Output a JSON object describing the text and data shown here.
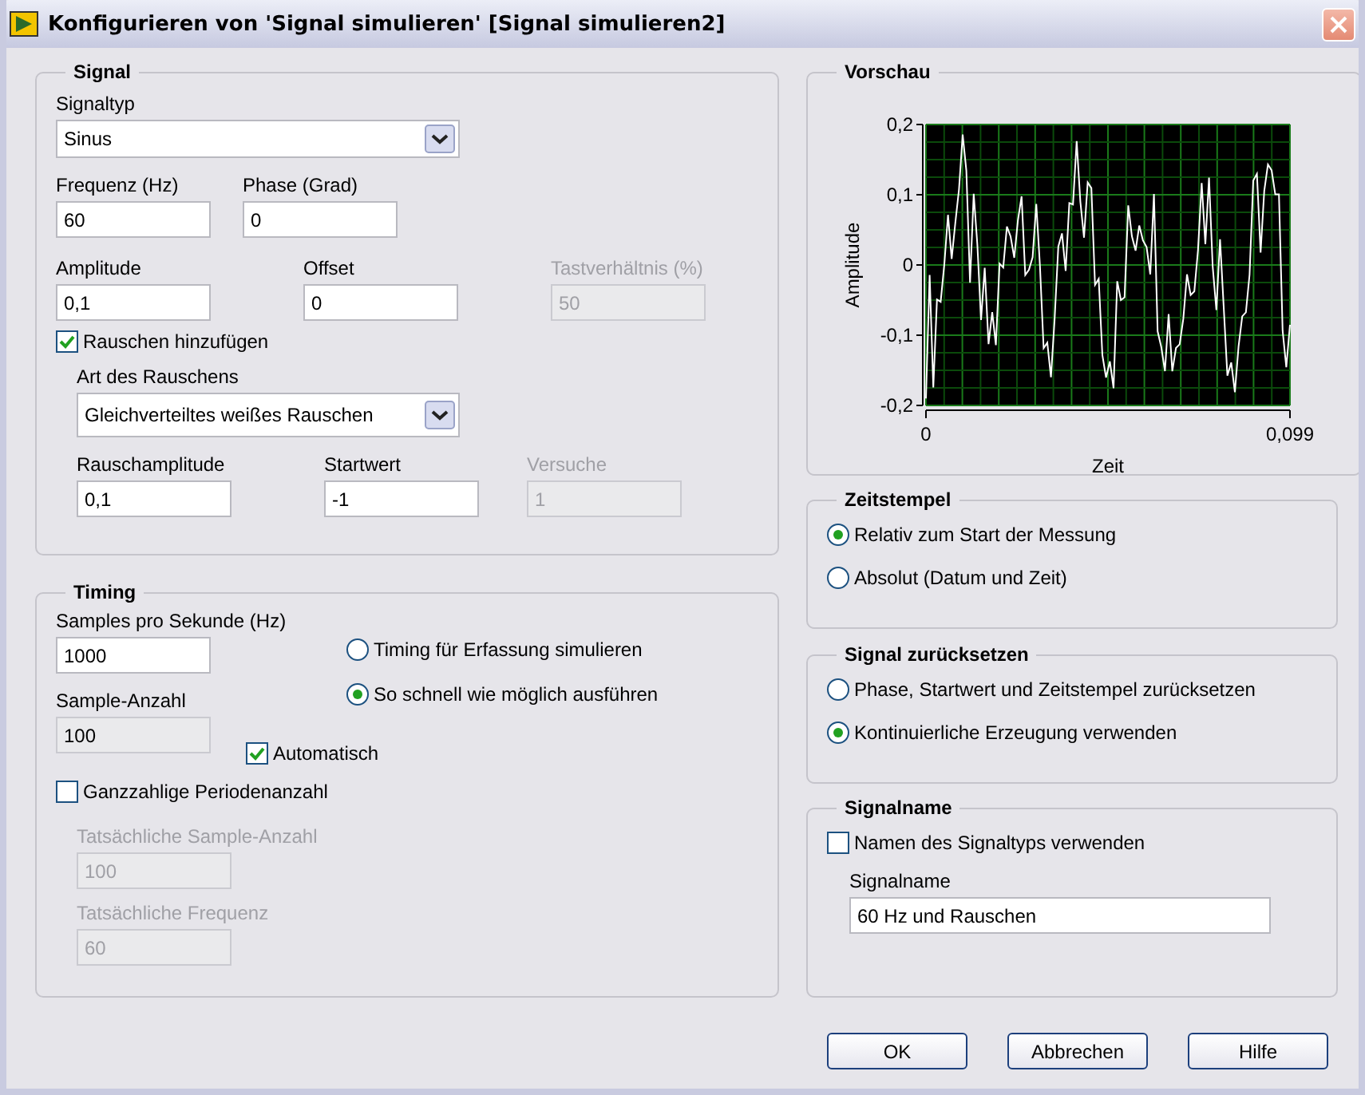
{
  "window": {
    "title": "Konfigurieren von 'Signal simulieren' [Signal simulieren2]"
  },
  "signal": {
    "title": "Signal",
    "signal_type": {
      "label": "Signaltyp",
      "value": "Sinus"
    },
    "row_1": [
      {
        "label": "Frequenz (Hz)",
        "value": "60",
        "editable": true,
        "disabled": false
      },
      {
        "label": "Phase (Grad)",
        "value": "0",
        "editable": true,
        "disabled": false
      }
    ],
    "row_2": [
      {
        "label": "Amplitude",
        "value": "0,1",
        "editable": true,
        "disabled": false
      },
      {
        "label": "Offset",
        "value": "0",
        "editable": true,
        "disabled": false
      },
      {
        "label": "Tastverhältnis (%)",
        "value": "50",
        "editable": false,
        "disabled": true
      }
    ],
    "add_noise": {
      "label": "Rauschen hinzufügen",
      "checked": true
    },
    "noise_type": {
      "label": "Art des Rauschens",
      "value": "Gleichverteiltes weißes Rauschen"
    },
    "noise_row": [
      {
        "label": "Rauschamplitude",
        "value": "0,1",
        "editable": true,
        "disabled": false
      },
      {
        "label": "Startwert",
        "value": "-1",
        "editable": true,
        "disabled": false
      },
      {
        "label": "Versuche",
        "value": "1",
        "editable": false,
        "disabled": true
      }
    ]
  },
  "timing": {
    "title": "Timing",
    "samples_per_second": {
      "label": "Samples pro Sekunde (Hz)",
      "value": "1000",
      "editable": true,
      "disabled": false
    },
    "sample_count": {
      "label": "Sample-Anzahl",
      "value": "100",
      "editable": false,
      "disabled": false
    },
    "automatic": {
      "label": "Automatisch",
      "checked": true
    },
    "modes": [
      {
        "label": "Timing für Erfassung simulieren",
        "selected": false
      },
      {
        "label": "So schnell wie möglich ausführen",
        "selected": true
      }
    ],
    "integer_periods": {
      "label": "Ganzzahlige Periodenanzahl",
      "checked": false
    },
    "actual_sample_count": {
      "label": "Tatsächliche Sample-Anzahl",
      "value": "100",
      "editable": false,
      "disabled": true
    },
    "actual_frequency": {
      "label": "Tatsächliche Frequenz",
      "value": "60",
      "editable": false,
      "disabled": true
    }
  },
  "preview": {
    "title": "Vorschau",
    "ylabel": "Amplitude",
    "xlabel": "Zeit",
    "yticks": [
      "0,2",
      "0,1",
      "0",
      "-0,1",
      "-0,2"
    ],
    "xticks": [
      "0",
      "0,099"
    ]
  },
  "timestamp": {
    "title": "Zeitstempel",
    "options": [
      {
        "label": "Relativ zum Start der Messung",
        "selected": true
      },
      {
        "label": "Absolut (Datum und Zeit)",
        "selected": false
      }
    ]
  },
  "reset": {
    "title": "Signal zurücksetzen",
    "options": [
      {
        "label": "Phase, Startwert und Zeitstempel zurücksetzen",
        "selected": false
      },
      {
        "label": "Kontinuierliche Erzeugung verwenden",
        "selected": true
      }
    ]
  },
  "signal_name": {
    "title": "Signalname",
    "use_type_name": {
      "label": "Namen des Signaltyps verwenden",
      "checked": false
    },
    "field": {
      "label": "Signalname",
      "value": "60 Hz und Rauschen",
      "editable": true,
      "disabled": false
    }
  },
  "buttons": [
    "OK",
    "Abbrechen",
    "Hilfe"
  ]
}
